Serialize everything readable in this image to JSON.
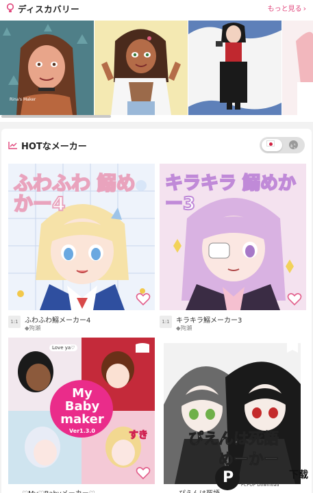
{
  "discovery": {
    "title": "ディスカバリー",
    "see_more": "もっと見る",
    "icon": "lightbulb-icon",
    "card1_caption": "Rina's Maker",
    "items": [
      {
        "bg": "#4f7f88"
      },
      {
        "bg": "#f4e9b2"
      },
      {
        "bg": "#5e80b9"
      },
      {
        "bg": "#f6e6e8"
      }
    ]
  },
  "hot": {
    "title": "HOTなメーカー",
    "icon": "trending-chart-icon",
    "region_toggle": {
      "selected": "japan-flag-icon",
      "other": "globe-icon"
    }
  },
  "makers": [
    {
      "ratio": "1:1",
      "name": "ふわふわ鰯メーカー4",
      "author": "◆殉瀬",
      "art_title": "ふわふわ 鰯めかー4"
    },
    {
      "ratio": "1:1",
      "name": "キラキラ鰯メーカー3",
      "author": "◆殉瀬",
      "art_title": "キラキラ 鰯めかー3"
    },
    {
      "ratio": "",
      "name": "♡My♡Babyメーカー♡",
      "author": "",
      "art_title": "My Baby maker",
      "art_version": "Ver1.3.0",
      "art_bubble": "Love ya♡",
      "art_sticker": "すき"
    },
    {
      "ratio": "",
      "name": "ぴえんは死語",
      "author": "",
      "art_title": "ぴえんは死語",
      "art_title2": "めーかー"
    }
  ],
  "watermark": {
    "text": "下载",
    "sub": "PCPOP Download"
  },
  "colors": {
    "accent": "#e0457b",
    "pink_heart": "#e25d8a"
  }
}
